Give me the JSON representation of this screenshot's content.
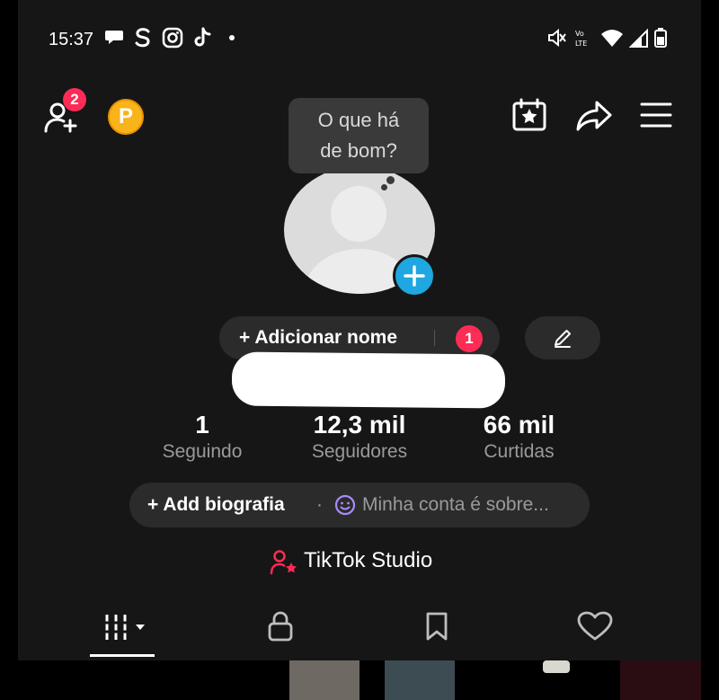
{
  "status_bar": {
    "time": "15:37"
  },
  "header": {
    "friend_requests_badge": "2",
    "points_badge_letter": "P"
  },
  "bubble": {
    "line1": "O que há",
    "line2": "de bom?"
  },
  "profile": {
    "add_name_label": "+ Adicionar nome",
    "add_name_badge": "1"
  },
  "stats": [
    {
      "value": "1",
      "label": "Seguindo"
    },
    {
      "value": "12,3 mil",
      "label": "Seguidores"
    },
    {
      "value": "66 mil",
      "label": "Curtidas"
    }
  ],
  "bio": {
    "add_label": "+ Add biografia",
    "separator": "·",
    "placeholder": "Minha conta é sobre..."
  },
  "studio": {
    "label": "TikTok Studio"
  },
  "colors": {
    "background": "#161616",
    "accent_red": "#fe2c55",
    "accent_blue": "#1ea7e0",
    "points_gold": "#f8b41a",
    "bio_emoji_purple": "#a78bfa"
  }
}
